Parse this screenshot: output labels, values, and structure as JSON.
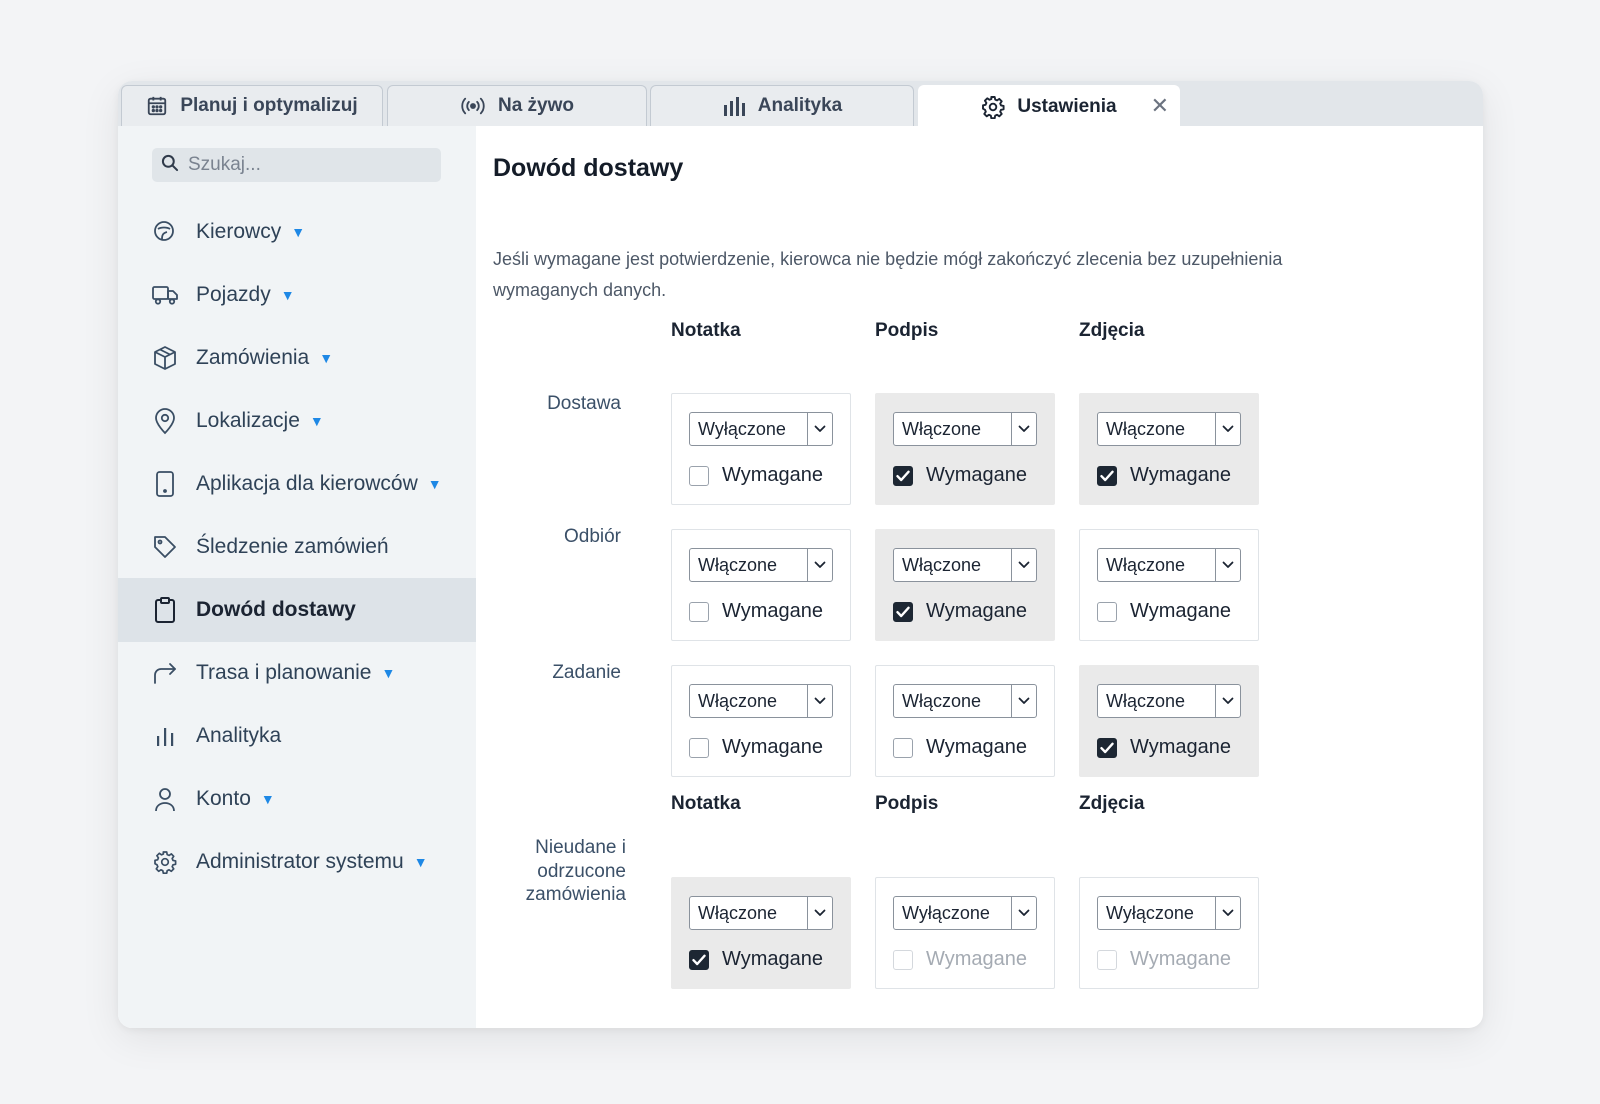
{
  "tabs": [
    {
      "label": "Planuj i optymalizuj",
      "icon": "calendar-icon"
    },
    {
      "label": "Na żywo",
      "icon": "broadcast-icon"
    },
    {
      "label": "Analityka",
      "icon": "bar-chart-icon"
    },
    {
      "label": "Ustawienia",
      "icon": "gear-icon",
      "active": true
    }
  ],
  "search": {
    "placeholder": "Szukaj..."
  },
  "sidebar": {
    "items": [
      {
        "label": "Kierowcy",
        "icon": "steering-icon",
        "caret": true
      },
      {
        "label": "Pojazdy",
        "icon": "truck-icon",
        "caret": true
      },
      {
        "label": "Zamówienia",
        "icon": "box-icon",
        "caret": true
      },
      {
        "label": "Lokalizacje",
        "icon": "map-pin-icon",
        "caret": true
      },
      {
        "label": "Aplikacja dla kierowców",
        "icon": "phone-icon",
        "caret": true
      },
      {
        "label": "Śledzenie zamówień",
        "icon": "tag-icon",
        "caret": false
      },
      {
        "label": "Dowód dostawy",
        "icon": "clipboard-icon",
        "caret": false,
        "active": true
      },
      {
        "label": "Trasa i planowanie",
        "icon": "route-arrow-icon",
        "caret": true
      },
      {
        "label": "Analityka",
        "icon": "bar-chart-icon",
        "caret": false
      },
      {
        "label": "Konto",
        "icon": "user-icon",
        "caret": true
      },
      {
        "label": "Administrator systemu",
        "icon": "gear-icon",
        "caret": true
      }
    ]
  },
  "main": {
    "title": "Dowód dostawy",
    "description": "Jeśli wymagane jest potwierdzenie, kierowca nie będzie mógł zakończyć zlecenia bez uzupełnienia wymaganych danych.",
    "columns": [
      "Notatka",
      "Podpis",
      "Zdjęcia"
    ],
    "rows": [
      {
        "label": "Dostawa",
        "cells": [
          {
            "select": "Wyłączone",
            "check_label": "Wymagane",
            "checked": false,
            "highlight": false,
            "disabled": false
          },
          {
            "select": "Włączone",
            "check_label": "Wymagane",
            "checked": true,
            "highlight": true,
            "disabled": false
          },
          {
            "select": "Włączone",
            "check_label": "Wymagane",
            "checked": true,
            "highlight": true,
            "disabled": false
          }
        ]
      },
      {
        "label": "Odbiór",
        "cells": [
          {
            "select": "Włączone",
            "check_label": "Wymagane",
            "checked": false,
            "highlight": false,
            "disabled": false
          },
          {
            "select": "Włączone",
            "check_label": "Wymagane",
            "checked": true,
            "highlight": true,
            "disabled": false
          },
          {
            "select": "Włączone",
            "check_label": "Wymagane",
            "checked": false,
            "highlight": false,
            "disabled": false
          }
        ]
      },
      {
        "label": "Zadanie",
        "cells": [
          {
            "select": "Włączone",
            "check_label": "Wymagane",
            "checked": false,
            "highlight": false,
            "disabled": false
          },
          {
            "select": "Włączone",
            "check_label": "Wymagane",
            "checked": false,
            "highlight": false,
            "disabled": false
          },
          {
            "select": "Włączone",
            "check_label": "Wymagane",
            "checked": true,
            "highlight": true,
            "disabled": false
          }
        ]
      }
    ],
    "failed": {
      "columns": [
        "Notatka",
        "Podpis",
        "Zdjęcia"
      ],
      "label_lines": [
        "Nieudane i",
        "odrzucone",
        "zamówienia"
      ],
      "cells": [
        {
          "select": "Włączone",
          "check_label": "Wymagane",
          "checked": true,
          "highlight": true,
          "disabled": false
        },
        {
          "select": "Wyłączone",
          "check_label": "Wymagane",
          "checked": false,
          "highlight": false,
          "disabled": true
        },
        {
          "select": "Wyłączone",
          "check_label": "Wymagane",
          "checked": false,
          "highlight": false,
          "disabled": true
        }
      ]
    }
  }
}
